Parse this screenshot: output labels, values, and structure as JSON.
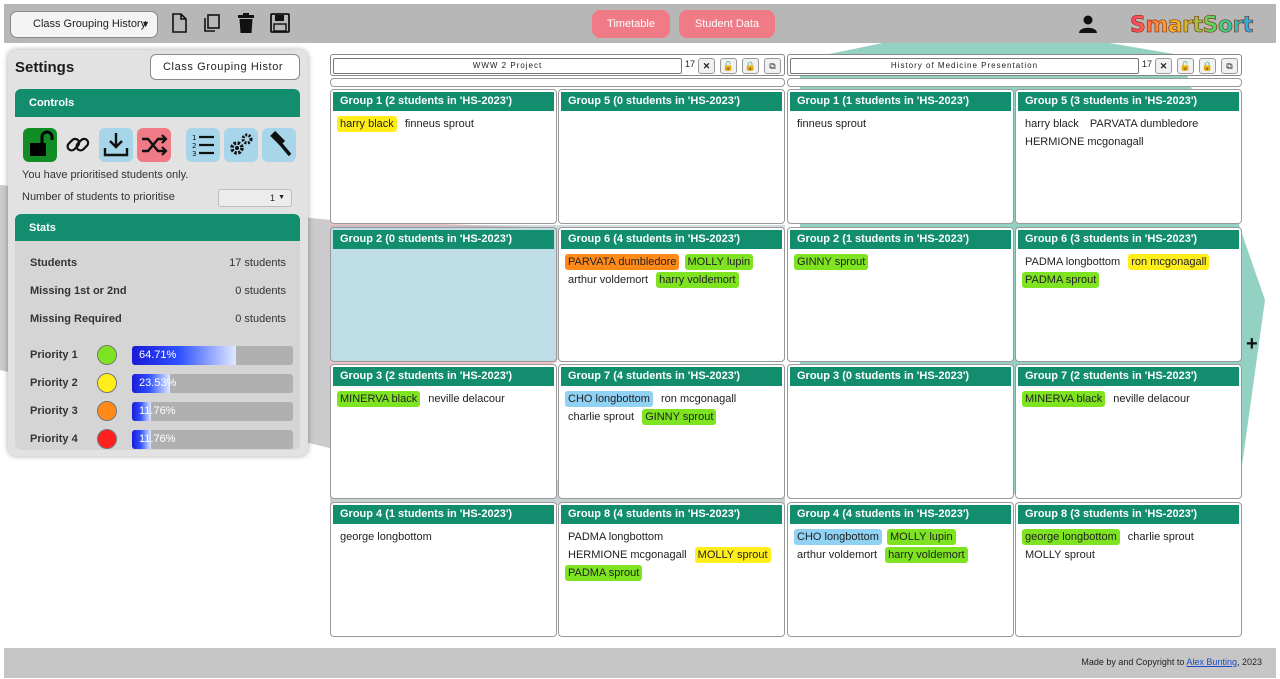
{
  "topbar": {
    "history_select": "Class Grouping History",
    "timetable_label": "Timetable",
    "student_data_label": "Student Data",
    "logo": "SmartSort"
  },
  "settings": {
    "title": "Settings",
    "history_value": "Class Grouping Histor",
    "controls_title": "Controls",
    "priority_note": "You have prioritised students only.",
    "priority_count_label": "Number of students to prioritise",
    "priority_count_value": "1",
    "stats_title": "Stats",
    "stats": [
      {
        "label": "Students",
        "value": "17 students"
      },
      {
        "label": "Missing 1st or 2nd",
        "value": "0 students"
      },
      {
        "label": "Missing Required",
        "value": "0 students"
      }
    ],
    "priorities": [
      {
        "label": "Priority 1",
        "color": "#7ee320",
        "percent_text": "64.71%",
        "fraction": 0.6471
      },
      {
        "label": "Priority 2",
        "color": "#ffee1a",
        "percent_text": "23.53%",
        "fraction": 0.2353
      },
      {
        "label": "Priority 3",
        "color": "#ff8a1a",
        "percent_text": "11.76%",
        "fraction": 0.1176
      },
      {
        "label": "Priority 4",
        "color": "#ff2020",
        "percent_text": "11.76%",
        "fraction": 0.1176
      }
    ]
  },
  "classes": [
    {
      "name": "WWW 2 Project",
      "count": "17",
      "groups": [
        {
          "title": "Group 1 (2 students in 'HS-2023')",
          "students": [
            {
              "name": "harry black",
              "p": "p2"
            },
            {
              "name": "finneus sprout",
              "p": ""
            }
          ]
        },
        {
          "title": "Group 5 (0 students in 'HS-2023')",
          "students": []
        },
        {
          "title": "Group 2 (0 students in 'HS-2023')",
          "students": [],
          "highlight": true
        },
        {
          "title": "Group 6 (4 students in 'HS-2023')",
          "students": [
            {
              "name": "PARVATA dumbledore",
              "p": "p3"
            },
            {
              "name": "MOLLY lupin",
              "p": "p1"
            },
            {
              "name": "arthur voldemort",
              "p": ""
            },
            {
              "name": "harry voldemort",
              "p": "p1"
            }
          ]
        },
        {
          "title": "Group 3 (2 students in 'HS-2023')",
          "students": [
            {
              "name": "MINERVA black",
              "p": "p1"
            },
            {
              "name": "neville delacour",
              "p": ""
            }
          ]
        },
        {
          "title": "Group 7 (4 students in 'HS-2023')",
          "students": [
            {
              "name": "CHO longbottom",
              "p": "p0"
            },
            {
              "name": "ron mcgonagall",
              "p": ""
            },
            {
              "name": "charlie sprout",
              "p": ""
            },
            {
              "name": "GINNY sprout",
              "p": "p1"
            }
          ]
        },
        {
          "title": "Group 4 (1 students in 'HS-2023')",
          "students": [
            {
              "name": "george longbottom",
              "p": ""
            }
          ]
        },
        {
          "title": "Group 8 (4 students in 'HS-2023')",
          "students": [
            {
              "name": "PADMA longbottom",
              "p": ""
            },
            {
              "name": "HERMIONE mcgonagall",
              "p": ""
            },
            {
              "name": "MOLLY sprout",
              "p": "p2"
            },
            {
              "name": "PADMA sprout",
              "p": "p1"
            }
          ]
        }
      ]
    },
    {
      "name": "History of Medicine Presentation",
      "count": "17",
      "groups": [
        {
          "title": "Group 1 (1 students in 'HS-2023')",
          "students": [
            {
              "name": "finneus sprout",
              "p": ""
            }
          ]
        },
        {
          "title": "Group 5 (3 students in 'HS-2023')",
          "students": [
            {
              "name": "harry black",
              "p": ""
            },
            {
              "name": "PARVATA dumbledore",
              "p": ""
            },
            {
              "name": "HERMIONE mcgonagall",
              "p": ""
            }
          ]
        },
        {
          "title": "Group 2 (1 students in 'HS-2023')",
          "students": [
            {
              "name": "GINNY sprout",
              "p": "p1"
            }
          ]
        },
        {
          "title": "Group 6 (3 students in 'HS-2023')",
          "students": [
            {
              "name": "PADMA longbottom",
              "p": ""
            },
            {
              "name": "ron mcgonagall",
              "p": "p2"
            },
            {
              "name": "PADMA sprout",
              "p": "p1"
            }
          ]
        },
        {
          "title": "Group 3 (0 students in 'HS-2023')",
          "students": []
        },
        {
          "title": "Group 7 (2 students in 'HS-2023')",
          "students": [
            {
              "name": "MINERVA black",
              "p": "p1"
            },
            {
              "name": "neville delacour",
              "p": ""
            }
          ]
        },
        {
          "title": "Group 4 (4 students in 'HS-2023')",
          "students": [
            {
              "name": "CHO longbottom",
              "p": "p0"
            },
            {
              "name": "MOLLY lupin",
              "p": "p1"
            },
            {
              "name": "arthur voldemort",
              "p": ""
            },
            {
              "name": "harry voldemort",
              "p": "p1"
            }
          ]
        },
        {
          "title": "Group 8 (3 students in 'HS-2023')",
          "students": [
            {
              "name": "george longbottom",
              "p": "p1"
            },
            {
              "name": "charlie sprout",
              "p": ""
            },
            {
              "name": "MOLLY sprout",
              "p": ""
            }
          ]
        }
      ]
    }
  ],
  "footer": {
    "prefix": "Made by and Copyright to ",
    "author": "Alex Bunting",
    "suffix": ", 2023"
  }
}
